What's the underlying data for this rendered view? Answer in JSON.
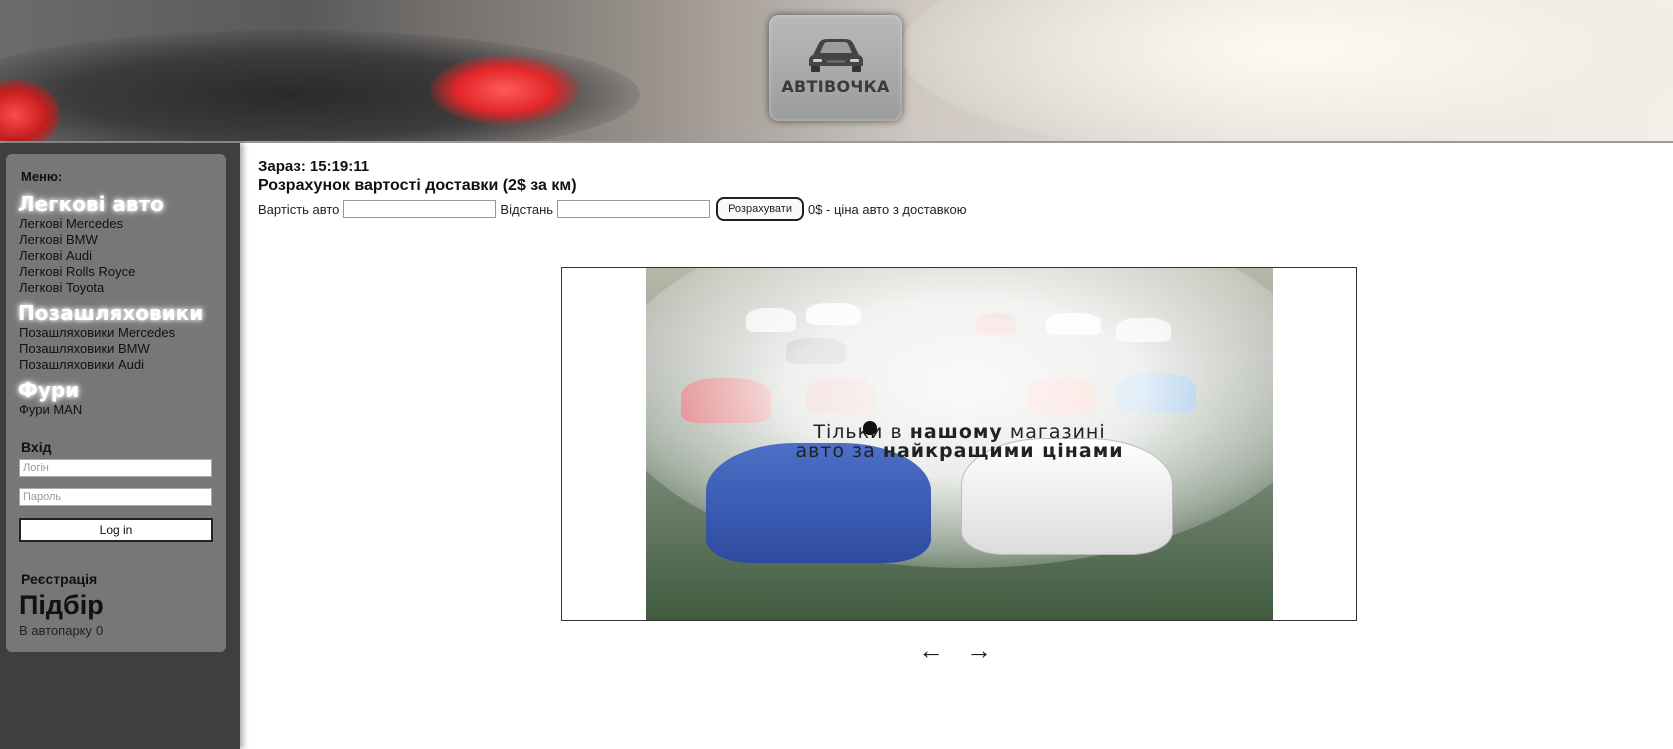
{
  "header": {
    "logo_text": "АВТІВОЧКА",
    "logo_icon": "car-icon"
  },
  "sidebar": {
    "menu_title": "Меню:",
    "categories": [
      {
        "title": "Легкові авто",
        "items": [
          "Легкові Mercedes",
          "Легкові BMW",
          "Легкові Audi",
          "Легкові Rolls Royce",
          "Легкові Toyota"
        ]
      },
      {
        "title": "Позашляховики",
        "items": [
          "Позашляховики Mercedes",
          "Позашляховики BMW",
          "Позашляховики Audi"
        ]
      },
      {
        "title": "Фури",
        "items": [
          "Фури MAN"
        ]
      }
    ],
    "login": {
      "title": "Вхід",
      "login_placeholder": "Логін",
      "password_placeholder": "Пароль",
      "button": "Log in"
    },
    "register_link": "Реєстрація",
    "pick_title": "Підбір",
    "park_label": "В автопарку",
    "park_count": "0"
  },
  "main": {
    "clock_label": "Зараз:",
    "clock_time": "15:19:11",
    "calc_title": "Розрахунок вартості доставки (2$ за км)",
    "car_price_label": "Вартість авто",
    "distance_label": "Відстань",
    "calc_button": "Розрахувати",
    "result_text": "0$ - ціна авто з доставкою"
  },
  "slider": {
    "line1_a": "Тільки в",
    "line1_b": "нашому",
    "line1_c": "магазині",
    "line2_a": "авто за",
    "line2_b": "найкращими цінами",
    "prev": "←",
    "next": "→"
  },
  "colors": {
    "sidebar_bg": "#3f3f3f",
    "sidebar_panel": "#777777"
  }
}
